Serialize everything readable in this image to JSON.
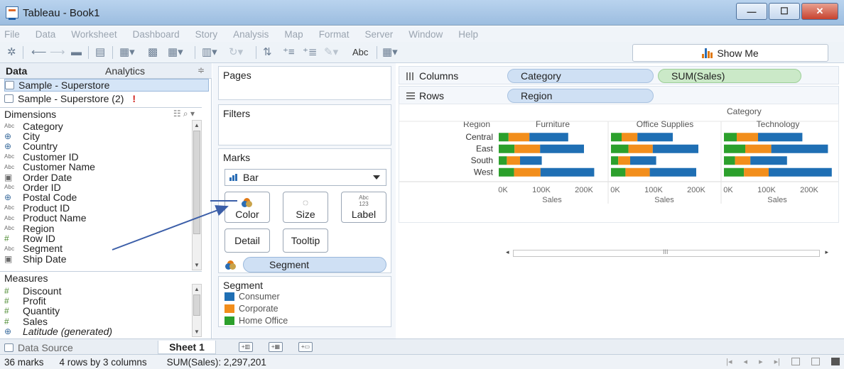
{
  "window": {
    "title": "Tableau - Book1",
    "min": "—",
    "max": "☐",
    "close": "✕"
  },
  "menu": [
    "File",
    "Data",
    "Worksheet",
    "Dashboard",
    "Story",
    "Analysis",
    "Map",
    "Format",
    "Server",
    "Window",
    "Help"
  ],
  "toolbar": {
    "show_me": "Show Me",
    "abc": "Abc"
  },
  "data_pane": {
    "tab_data": "Data",
    "tab_analytics": "Analytics",
    "pin": "≑",
    "sources": [
      "Sample - Superstore",
      "Sample - Superstore (2)"
    ],
    "warning": "!",
    "dimensions_label": "Dimensions",
    "dimensions": [
      {
        "type": "Abc",
        "name": "Category"
      },
      {
        "type": "geo",
        "name": "City"
      },
      {
        "type": "geo",
        "name": "Country"
      },
      {
        "type": "Abc",
        "name": "Customer ID"
      },
      {
        "type": "Abc",
        "name": "Customer Name"
      },
      {
        "type": "date",
        "name": "Order Date"
      },
      {
        "type": "Abc",
        "name": "Order ID"
      },
      {
        "type": "geo",
        "name": "Postal Code"
      },
      {
        "type": "Abc",
        "name": "Product ID"
      },
      {
        "type": "Abc",
        "name": "Product Name"
      },
      {
        "type": "Abc",
        "name": "Region"
      },
      {
        "type": "num",
        "name": "Row ID"
      },
      {
        "type": "Abc",
        "name": "Segment"
      },
      {
        "type": "date",
        "name": "Ship Date"
      }
    ],
    "measures_label": "Measures",
    "measures": [
      {
        "type": "num",
        "name": "Discount",
        "italic": false
      },
      {
        "type": "num",
        "name": "Profit",
        "italic": false
      },
      {
        "type": "num",
        "name": "Quantity",
        "italic": false
      },
      {
        "type": "num",
        "name": "Sales",
        "italic": false
      },
      {
        "type": "geo",
        "name": "Latitude (generated)",
        "italic": true
      }
    ]
  },
  "cards": {
    "pages": "Pages",
    "filters": "Filters",
    "marks": "Marks",
    "mark_type": "Bar",
    "color": "Color",
    "size": "Size",
    "label": "Label",
    "label_glyph": "Abc 123",
    "detail": "Detail",
    "tooltip": "Tooltip",
    "segment_pill": "Segment",
    "legend_title": "Segment",
    "legend": [
      {
        "name": "Consumer",
        "color": "#1f6fb4"
      },
      {
        "name": "Corporate",
        "color": "#f28e1c"
      },
      {
        "name": "Home Office",
        "color": "#2ca02c"
      }
    ]
  },
  "shelves": {
    "columns_label": "Columns",
    "rows_label": "Rows",
    "columns_pills": [
      "Category",
      "SUM(Sales)"
    ],
    "rows_pills": [
      "Region"
    ]
  },
  "chart_data": {
    "type": "bar",
    "stacked": true,
    "orientation": "horizontal",
    "column_header": "Category",
    "row_header": "Region",
    "panels": [
      "Furniture",
      "Office Supplies",
      "Technology"
    ],
    "categories": [
      "Central",
      "East",
      "South",
      "West"
    ],
    "xlabel": "Sales",
    "xticks": [
      "0K",
      "100K",
      "200K"
    ],
    "xlim": [
      0,
      250000
    ],
    "series": [
      {
        "name": "Consumer",
        "color": "#1f6fb4",
        "values": {
          "Furniture": [
            91000,
            103000,
            51000,
            126000
          ],
          "Office Supplies": [
            83000,
            107000,
            61000,
            109000
          ],
          "Technology": [
            104000,
            133000,
            86000,
            148000
          ]
        }
      },
      {
        "name": "Corporate",
        "color": "#f28e1c",
        "values": {
          "Furniture": [
            49000,
            60000,
            31000,
            62000
          ],
          "Office Supplies": [
            37000,
            57000,
            28000,
            57000
          ],
          "Technology": [
            50000,
            61000,
            36000,
            58000
          ]
        }
      },
      {
        "name": "Home Office",
        "color": "#2ca02c",
        "values": {
          "Furniture": [
            23000,
            37000,
            19000,
            36000
          ],
          "Office Supplies": [
            25000,
            41000,
            17000,
            34000
          ],
          "Technology": [
            30000,
            50000,
            26000,
            47000
          ]
        }
      }
    ]
  },
  "scroll_mid": "III",
  "tabs": {
    "data_source": "Data Source",
    "sheet": "Sheet 1"
  },
  "status": {
    "marks": "36 marks",
    "rows_cols": "4 rows by 3 columns",
    "sum": "SUM(Sales): 2,297,201"
  }
}
